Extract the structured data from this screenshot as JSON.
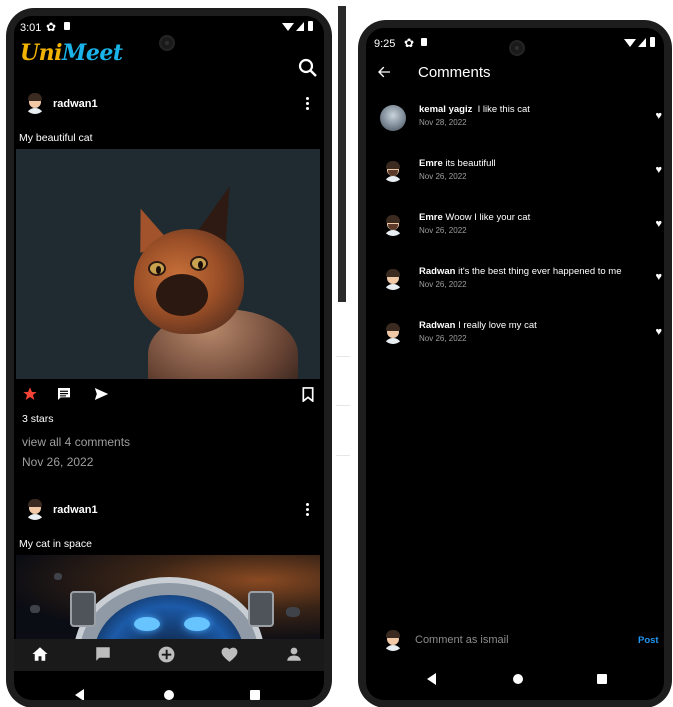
{
  "left_screen": {
    "status": {
      "time": "3:01"
    },
    "app": {
      "logo_part1": "Uni",
      "logo_part2": "Meet"
    },
    "posts": [
      {
        "username": "radwan1",
        "caption": "My beautiful cat",
        "stars": "3 stars",
        "view_comments": "view all 4 comments",
        "date": "Nov 26, 2022"
      },
      {
        "username": "radwan1",
        "caption": "My cat in space"
      }
    ],
    "bottom_nav": [
      "home-icon",
      "chat-icon",
      "add-circle-icon",
      "heart-icon",
      "person-icon"
    ]
  },
  "right_screen": {
    "status": {
      "time": "9:25"
    },
    "header": {
      "title": "Comments"
    },
    "comments": [
      {
        "author": "kemal yagiz",
        "text": "I like this cat",
        "date": "Nov 28, 2022"
      },
      {
        "author": "Emre",
        "text": "its beautifull",
        "date": "Nov 26, 2022"
      },
      {
        "author": "Emre",
        "text": "Woow I like your cat",
        "date": "Nov 26, 2022"
      },
      {
        "author": "Radwan",
        "text": "it's the best thing ever happened to me",
        "date": "Nov 26, 2022"
      },
      {
        "author": "Radwan",
        "text": "I really love my cat",
        "date": "Nov 26, 2022"
      }
    ],
    "input": {
      "placeholder": "Comment as ismail",
      "post_label": "Post"
    }
  },
  "colors": {
    "logo_yellow": "#f2b300",
    "logo_blue": "#1ab4ea",
    "star_red": "#f44336",
    "post_blue": "#2196f3",
    "background": "#000000"
  }
}
